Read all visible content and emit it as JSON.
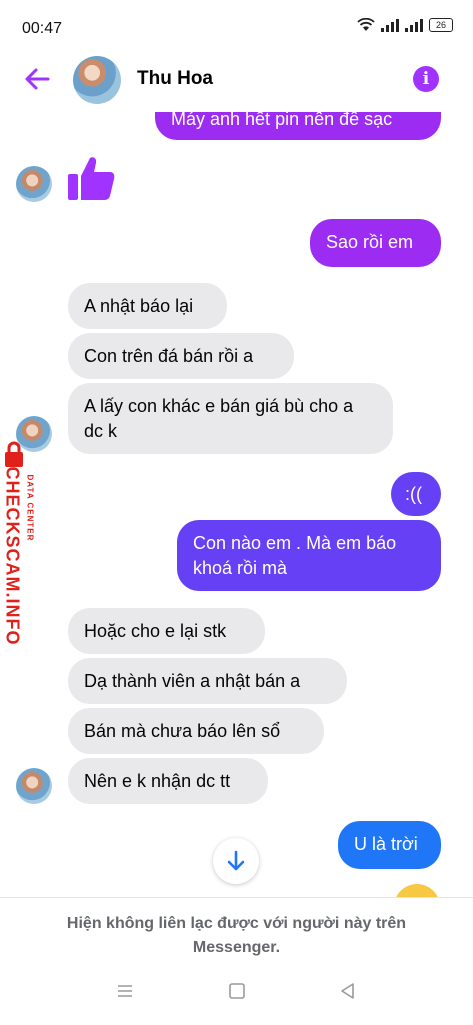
{
  "status": {
    "time": "00:47",
    "battery": "26"
  },
  "header": {
    "name": "Thu Hoa"
  },
  "messages": [
    {
      "text": "Máy anh hết pin nên để sạc"
    },
    {
      "text": "Sao rồi em"
    },
    {
      "text": "A nhật báo lại"
    },
    {
      "text": "Con trên đá bán rồi a"
    },
    {
      "text": "A lấy con khác e bán giá bù cho a dc k"
    },
    {
      "text": ":(("
    },
    {
      "text": "Con nào em . Mà em báo khoá rồi mà"
    },
    {
      "text": "Hoặc cho e lại stk"
    },
    {
      "text": "Dạ thành viên a nhật bán a"
    },
    {
      "text": "Bán mà chưa báo lên sổ"
    },
    {
      "text": "Nên e k nhận dc tt"
    },
    {
      "text": "U là trời"
    }
  ],
  "watermark": {
    "brand": "CHECKSCAM.INFO",
    "sub": "DATA CENTER"
  },
  "footer": {
    "notice": "Hiện không liên lạc được với người này trên Messenger."
  },
  "icons": {
    "back": "arrow-left-icon",
    "info": "info-icon",
    "like": "thumbs-up-icon",
    "scroll": "arrow-down-icon"
  },
  "colors": {
    "accent": "#a033ff",
    "incoming": "#e9e9eb",
    "outgoing_top": "#9c2cf2",
    "outgoing_bottom": "#1f77f7"
  }
}
